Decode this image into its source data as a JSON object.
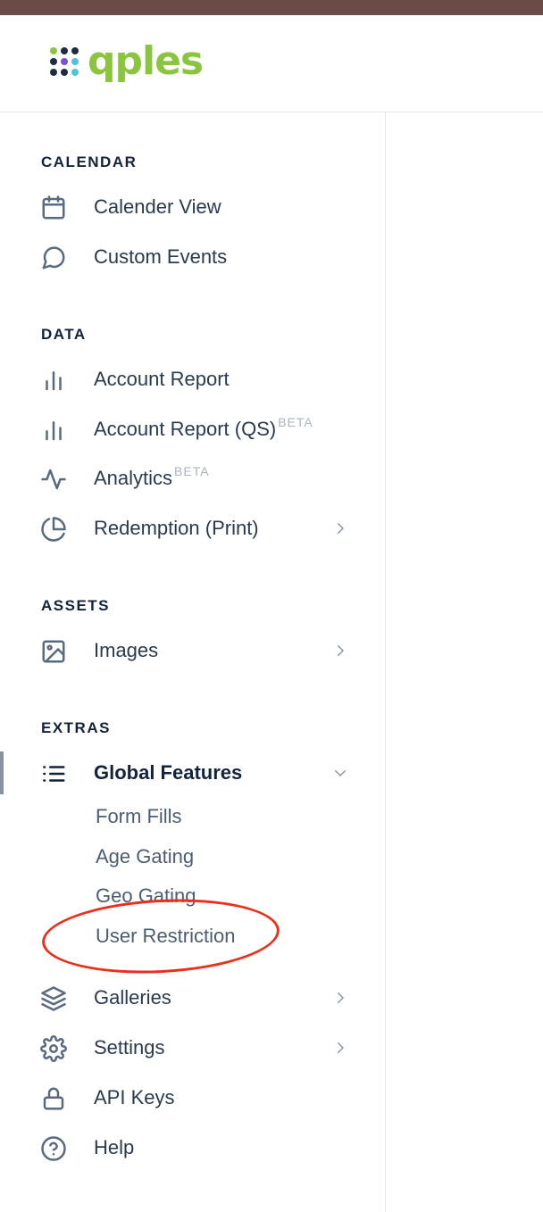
{
  "brand": {
    "name": "qples",
    "text_color": "#8bc53f"
  },
  "colors": {
    "topbar": "#6b4b48",
    "annotation": "#e8301c"
  },
  "sections": {
    "calendar": {
      "title": "CALENDAR",
      "items": [
        {
          "label": "Calender View",
          "icon": "calendar-icon"
        },
        {
          "label": "Custom Events",
          "icon": "chat-bubble-icon"
        }
      ]
    },
    "data": {
      "title": "DATA",
      "items": [
        {
          "label": "Account Report",
          "icon": "bar-chart-icon"
        },
        {
          "label": "Account Report (QS)",
          "badge": "BETA",
          "icon": "bar-chart-icon"
        },
        {
          "label": "Analytics",
          "badge": "BETA",
          "icon": "activity-icon"
        },
        {
          "label": "Redemption (Print)",
          "icon": "pie-chart-icon",
          "has_submenu": true
        }
      ]
    },
    "assets": {
      "title": "ASSETS",
      "items": [
        {
          "label": "Images",
          "icon": "image-icon",
          "has_submenu": true
        }
      ]
    },
    "extras": {
      "title": "EXTRAS",
      "global_features": {
        "label": "Global Features",
        "icon": "list-icon",
        "expanded": true,
        "children": [
          "Form Fills",
          "Age Gating",
          "Geo Gating",
          "User Restriction"
        ]
      },
      "items": [
        {
          "label": "Galleries",
          "icon": "layers-icon",
          "has_submenu": true
        },
        {
          "label": "Settings",
          "icon": "gear-icon",
          "has_submenu": true
        },
        {
          "label": "API Keys",
          "icon": "lock-icon"
        },
        {
          "label": "Help",
          "icon": "help-circle-icon"
        }
      ]
    }
  }
}
